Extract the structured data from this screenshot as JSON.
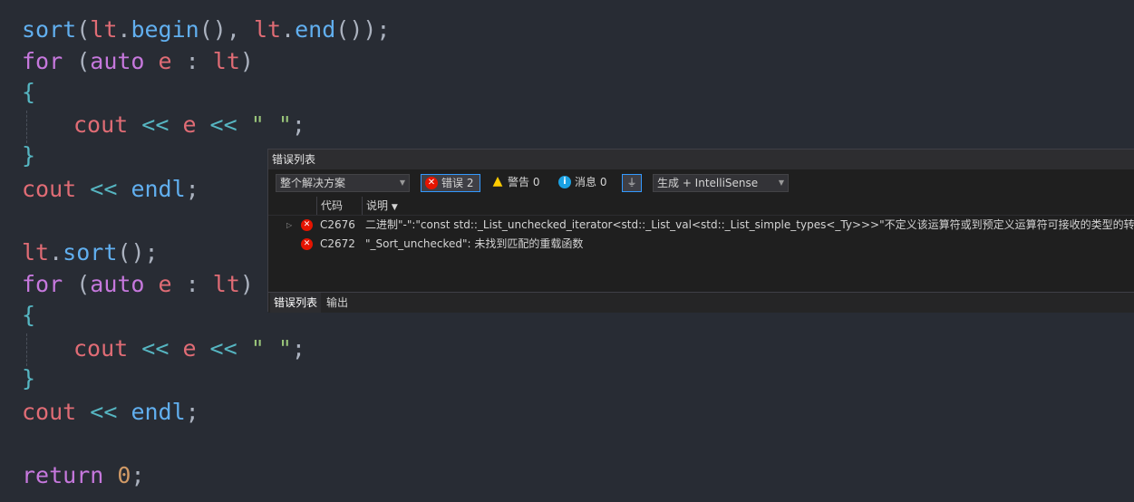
{
  "editor": {
    "line1": {
      "fn": "sort",
      "open": "(",
      "v1": "lt",
      "dot1": ".",
      "m1": "begin",
      "p1": "(), ",
      "v2": "lt",
      "dot2": ".",
      "m2": "end",
      "p2": "());"
    },
    "line2": {
      "kw": "for",
      "sp": " ",
      "open": "(",
      "kw2": "auto",
      "v": " e",
      "colon": " : ",
      "lt": "lt",
      "close": ")"
    },
    "line3": {
      "brace": "{"
    },
    "line4": {
      "cout": "cout",
      "op1": " << ",
      "e": "e",
      "op2": " << ",
      "str": "\" \"",
      "semi": ";"
    },
    "line5": {
      "brace": "}"
    },
    "line6": {
      "cout": "cout",
      "op": " << ",
      "endl": "endl",
      "semi": ";"
    },
    "line7": {
      "v": "lt",
      "dot": ".",
      "m": "sort",
      "p": "();"
    },
    "line8": {
      "kw": "for",
      "sp": " ",
      "open": "(",
      "kw2": "auto",
      "v": " e",
      "colon": " : ",
      "lt": "lt",
      "close": ")"
    },
    "line9": {
      "brace": "{"
    },
    "line10": {
      "cout": "cout",
      "op1": " << ",
      "e": "e",
      "op2": " << ",
      "str": "\" \"",
      "semi": ";"
    },
    "line11": {
      "brace": "}"
    },
    "line12": {
      "cout": "cout",
      "op": " << ",
      "endl": "endl",
      "semi": ";"
    },
    "line13": {
      "kw": "return",
      "sp": " ",
      "num": "0",
      "semi": ";"
    }
  },
  "error_list": {
    "title": "错误列表",
    "scope_value": "整个解决方案",
    "errors_label": "错误 2",
    "warnings_label": "警告 0",
    "messages_label": "消息 0",
    "build_filter_value": "生成 + IntelliSense",
    "columns": {
      "code": "代码",
      "description": "说明"
    },
    "rows": [
      {
        "code": "C2676",
        "description": "二进制\"-\":\"const std::_List_unchecked_iterator<std::_List_val<std::_List_simple_types<_Ty>>>\"不定义该运算符或到预定义运算符可接收的类型的转换"
      },
      {
        "code": "C2672",
        "description": "\"_Sort_unchecked\": 未找到匹配的重载函数"
      }
    ],
    "bottom_tabs": {
      "error_list": "错误列表",
      "output": "输出"
    }
  },
  "colors": {
    "function": "#61afef",
    "keyword": "#c678dd",
    "variable": "#e06c75",
    "operator": "#56b6c2",
    "string": "#98c379",
    "number": "#d19a66",
    "error_icon": "#e51400"
  },
  "icons": {
    "error": "error-circle-icon",
    "warning": "warning-triangle-icon",
    "info": "info-circle-icon",
    "filter": "filter-icon",
    "expand": "expand-triangle-icon"
  }
}
